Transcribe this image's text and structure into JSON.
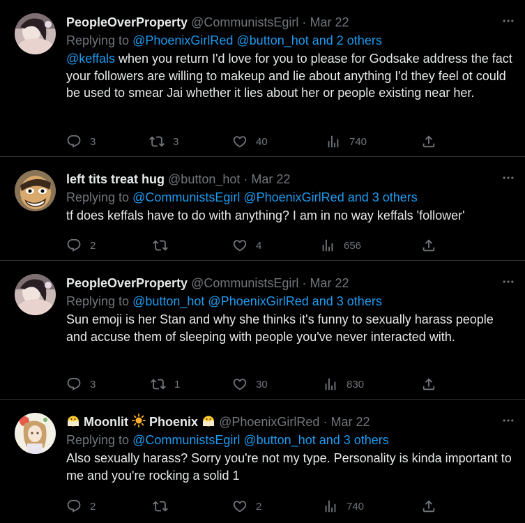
{
  "tweets": [
    {
      "name": "PeopleOverProperty",
      "handle": "@CommunistsEgirl",
      "dot": "·",
      "date": "Mar 22",
      "replying_prefix": "Replying to ",
      "replying_links": "@PhoenixGirlRed @button_hot and 2 others",
      "mention": "@keffals",
      "text": " when you return I'd love for you to please for Godsake address the fact your followers are willing to makeup and lie about anything I'd they feel ot could be used to smear Jai whether it lies about her or people existing near her.",
      "replies": "3",
      "retweets": "3",
      "likes": "40",
      "views": "740",
      "avatar_icon": "pale-portrait-avatar"
    },
    {
      "name": "left tits treat hug",
      "handle": "@button_hot",
      "dot": "·",
      "date": "Mar 22",
      "replying_prefix": "Replying to ",
      "replying_links": "@CommunistsEgirl @PhoenixGirlRed and 3 others",
      "text": "tf does keffals have to do with anything? I am in no way keffals 'follower'",
      "replies": "2",
      "retweets": "",
      "likes": "4",
      "views": "656",
      "avatar_icon": "cartoon-face-avatar"
    },
    {
      "name": "PeopleOverProperty",
      "handle": "@CommunistsEgirl",
      "dot": "·",
      "date": "Mar 22",
      "replying_prefix": "Replying to ",
      "replying_links": "@button_hot @PhoenixGirlRed and 3 others",
      "text": "Sun emoji is her Stan and why she thinks it's funny to sexually harass people and accuse them of sleeping with people you've never interacted with.",
      "replies": "3",
      "retweets": "1",
      "likes": "30",
      "views": "830",
      "avatar_icon": "pale-portrait-avatar"
    },
    {
      "name_part1": "Moonlit",
      "name_part2": "Phoenix",
      "handle": "@PhoenixGirlRed",
      "dot": "·",
      "date": "Mar 22",
      "replying_prefix": "Replying to ",
      "replying_links": "@CommunistsEgirl @button_hot and 3 others",
      "text": "Also sexually harass? Sorry you're not my type. Personality is kinda important to me and you're rocking a solid 1",
      "replies": "2",
      "retweets": "",
      "likes": "2",
      "views": "740",
      "avatar_icon": "anime-girl-avatar",
      "name_emojis": [
        "hatching-chick-icon",
        "sun-icon",
        "hatching-chick-icon"
      ]
    }
  ],
  "colors": {
    "background": "#000000",
    "text": "#e7e9ea",
    "muted": "#71767b",
    "link": "#1d9bf0",
    "divider": "#2f3336"
  }
}
